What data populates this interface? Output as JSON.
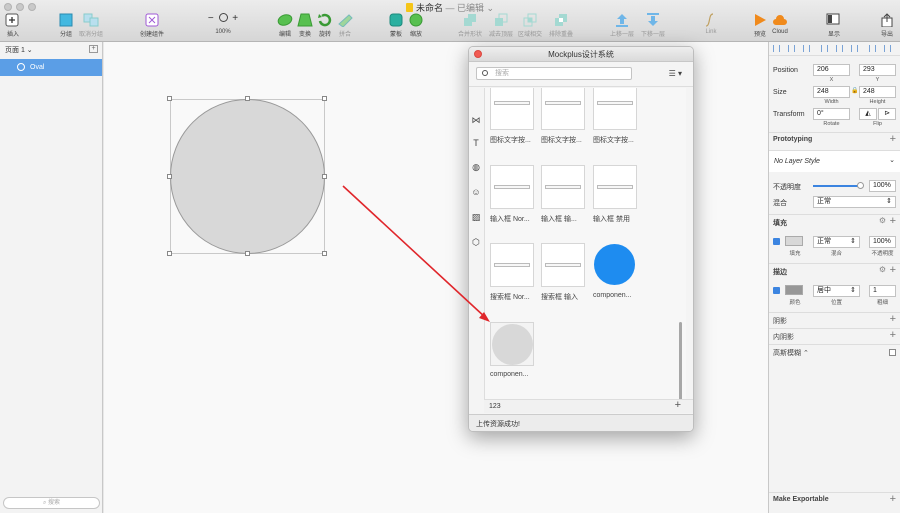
{
  "window": {
    "title": "未命名",
    "subtitle": "— 已编辑",
    "chevron": "⌄"
  },
  "toolbar": {
    "insert": "插入",
    "group": "分组",
    "ungroup": "取消分组",
    "create_symbol": "创建组件",
    "zoom_minus": "−",
    "zoom_plus": "+",
    "zoom": "100%",
    "edit": "编辑",
    "transform": "变换",
    "rotate": "旋转",
    "flatten": "拼合",
    "mask": "蒙板",
    "scale": "缩放",
    "union": "合并形状",
    "subtract": "减去顶层",
    "intersect": "区域相交",
    "difference": "排除重叠",
    "forward": "上移一层",
    "backward": "下移一层",
    "link": "Link",
    "preview": "预览",
    "cloud": "Cloud",
    "view": "显示",
    "export": "导出"
  },
  "sidebar": {
    "page": "页面 1 ⌄",
    "add_page": "+",
    "layers": [
      {
        "label": "Oval"
      }
    ],
    "search_placeholder": "搜索"
  },
  "panel": {
    "title": "Mockplus设计系统",
    "search_placeholder": "搜索",
    "menu": "☰ ▾",
    "items": [
      {
        "label": "图标文字按...",
        "kind": "button"
      },
      {
        "label": "图标文字按...",
        "kind": "button"
      },
      {
        "label": "图标文字按...",
        "kind": "button"
      },
      {
        "label": "输入框 Nor...",
        "kind": "input"
      },
      {
        "label": "输入框 输...",
        "kind": "input"
      },
      {
        "label": "输入框 禁用",
        "kind": "input"
      },
      {
        "label": "搜索框 Nor...",
        "kind": "input"
      },
      {
        "label": "搜索框 输入",
        "kind": "input"
      },
      {
        "label": "componen...",
        "kind": "blue-circle"
      },
      {
        "label": "componen...",
        "kind": "grey-circle"
      }
    ],
    "group_name": "123",
    "group_add": "+",
    "status": "上传资源成功!"
  },
  "inspector": {
    "position_label": "Position",
    "x": "206",
    "y": "293",
    "x_label": "X",
    "y_label": "Y",
    "size_label": "Size",
    "width": "248",
    "height": "248",
    "width_label": "Width",
    "height_label": "Height",
    "lock": "🔒",
    "transform_label": "Transform",
    "rotate_value": "0°",
    "rotate_label": "Rotate",
    "flip_label": "Flip",
    "flip_h": "◭",
    "flip_v": "⊳",
    "prototyping": "Prototyping",
    "layer_style": "No Layer Style",
    "opacity_label": "不透明度",
    "opacity_value": "100%",
    "opacity": 0.95,
    "blend_label": "混合",
    "blend_value": "正常",
    "fill_section": "填充",
    "fill_sub": "填充",
    "fill_blend": "正常",
    "fill_blend_sub": "混合",
    "fill_opacity": "100%",
    "fill_opacity_sub": "不透明度",
    "fill_color": "#d8d8d8",
    "border_section": "描边",
    "border_sub": "颜色",
    "border_position": "居中",
    "border_position_sub": "位置",
    "border_width": "1",
    "border_width_sub": "粗细",
    "border_color": "#979797",
    "shadow": "阴影",
    "inner_shadow": "内阴影",
    "blur": "高斯模糊 ⌃",
    "make_exportable": "Make Exportable"
  },
  "colors": {
    "accent": "#3b84e0",
    "selection": "#5b9ee6",
    "arrow": "#e0262b",
    "close": "#f25a52",
    "component_blue": "#1e8cf0"
  }
}
